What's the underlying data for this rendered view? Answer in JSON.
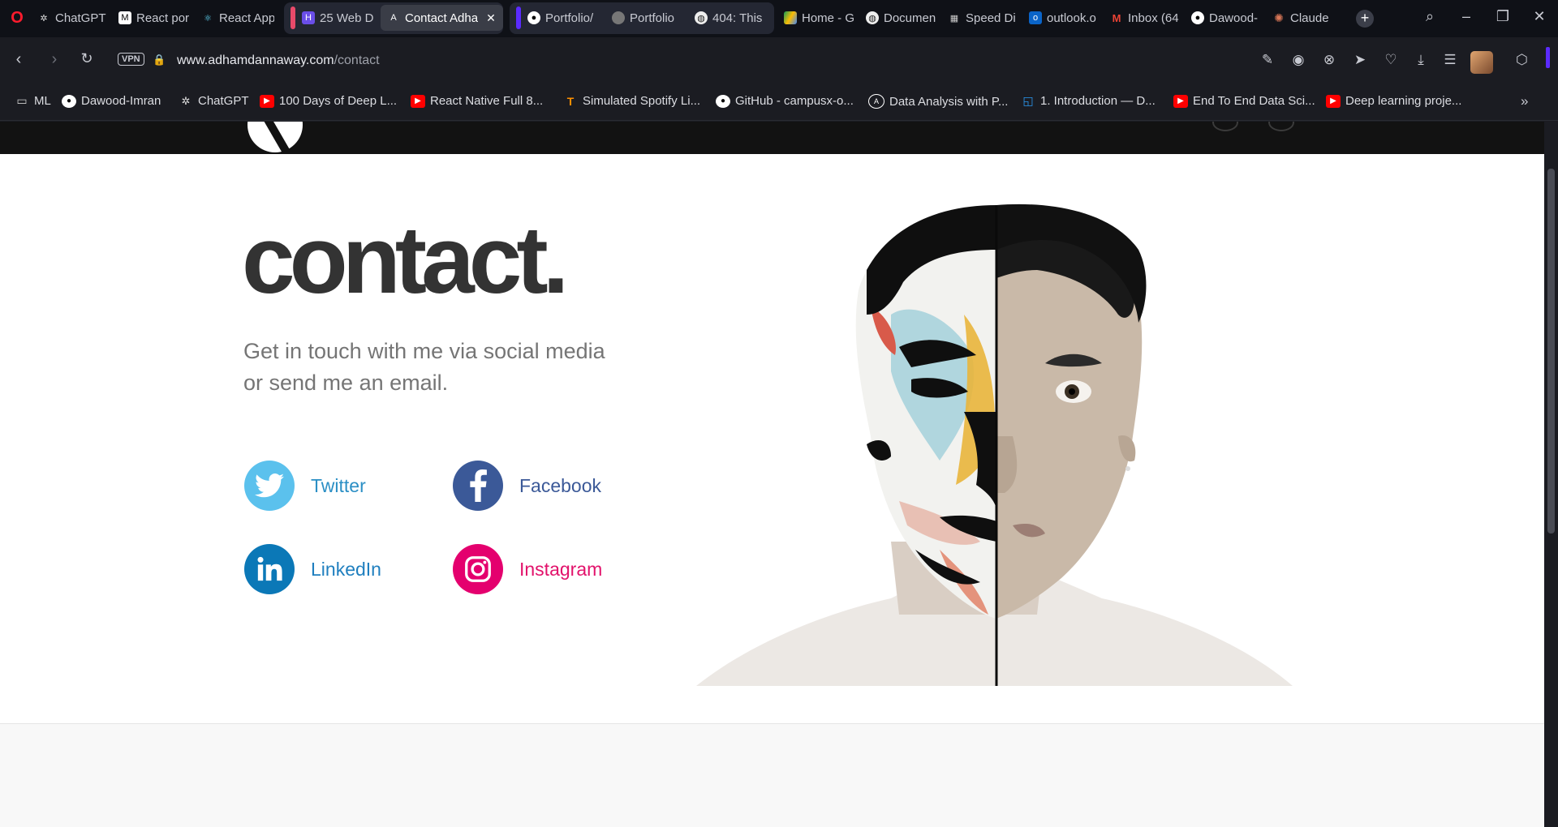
{
  "browser": {
    "tabs": [
      {
        "label": "ChatGPT",
        "icon": "chatgpt-icon"
      },
      {
        "label": "React por",
        "icon": "react-portfolio-icon"
      },
      {
        "label": "React App",
        "icon": "react-icon"
      },
      {
        "label": "25 Web D",
        "icon": "web-dev-icon"
      },
      {
        "label": "Contact Adha",
        "icon": "adham-logo-icon",
        "active": true
      },
      {
        "label": "Portfolio/",
        "icon": "github-icon"
      },
      {
        "label": "Portfolio",
        "icon": "portfolio-icon"
      },
      {
        "label": "404: This",
        "icon": "globe-icon"
      },
      {
        "label": "Home - G",
        "icon": "google-drive-icon"
      },
      {
        "label": "Documen",
        "icon": "globe-icon"
      },
      {
        "label": "Speed Di",
        "icon": "speed-dial-icon"
      },
      {
        "label": "outlook.o",
        "icon": "outlook-icon"
      },
      {
        "label": "Inbox (64",
        "icon": "gmail-icon"
      },
      {
        "label": "Dawood-",
        "icon": "github-icon"
      },
      {
        "label": "Claude",
        "icon": "claude-icon"
      }
    ],
    "address": {
      "vpn_label": "VPN",
      "url_host": "www.adhamdannaway.com",
      "url_path": "/contact"
    },
    "bookmarks": [
      {
        "label": "ML",
        "icon": "folder-icon"
      },
      {
        "label": "Dawood-Imran",
        "icon": "github-icon"
      },
      {
        "label": "ChatGPT",
        "icon": "chatgpt-icon"
      },
      {
        "label": "100 Days of Deep L...",
        "icon": "youtube-icon"
      },
      {
        "label": "React Native Full 8...",
        "icon": "youtube-icon"
      },
      {
        "label": "Simulated Spotify Li...",
        "icon": "tensorflow-icon"
      },
      {
        "label": "GitHub - campusx-o...",
        "icon": "github-icon"
      },
      {
        "label": "Data Analysis with P...",
        "icon": "anaconda-icon"
      },
      {
        "label": "1. Introduction — D...",
        "icon": "docs-icon"
      },
      {
        "label": "End To End Data Sci...",
        "icon": "youtube-icon"
      },
      {
        "label": "Deep learning proje...",
        "icon": "youtube-icon"
      }
    ]
  },
  "page": {
    "title": "contact.",
    "intro_line1": "Get in touch with me via social media",
    "intro_line2": "or send me an email.",
    "social": [
      {
        "label": "Twitter",
        "color": "#5bc1ed",
        "text_color": "#2b8fc5",
        "icon": "twitter-bird-icon"
      },
      {
        "label": "Facebook",
        "color": "#3b5998",
        "text_color": "#3b5998",
        "icon": "facebook-icon"
      },
      {
        "label": "LinkedIn",
        "color": "#0b78b7",
        "text_color": "#1f7fbf",
        "icon": "linkedin-icon"
      },
      {
        "label": "Instagram",
        "color": "#e4006e",
        "text_color": "#e2126b",
        "icon": "instagram-icon"
      }
    ]
  }
}
